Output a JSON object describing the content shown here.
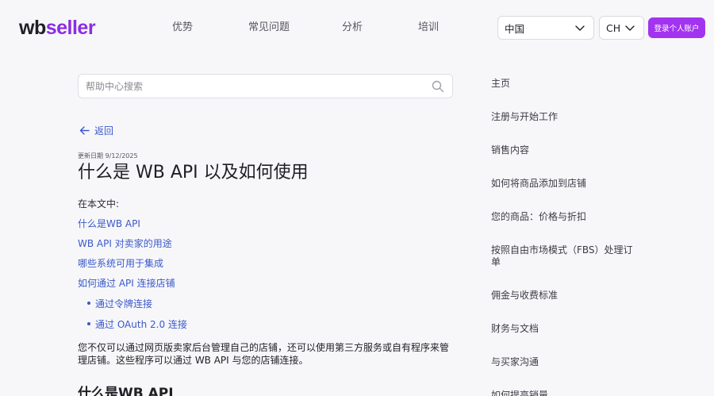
{
  "header": {
    "logo_wb": "wb",
    "logo_seller": "seller",
    "nav": [
      "优势",
      "常见问题",
      "分析",
      "培训"
    ],
    "country": "中国",
    "language": "CH",
    "login_label": "登录个人账户"
  },
  "search": {
    "placeholder": "帮助中心搜索"
  },
  "article": {
    "back_label": "返回",
    "updated": "更新日期 9/12/2025",
    "title": "什么是 WB API 以及如何使用",
    "toc_label": "在本文中:",
    "toc": [
      "什么是WB API",
      "WB API 对卖家的用途",
      "哪些系统可用于集成",
      "如何通过 API 连接店铺"
    ],
    "toc_sub": [
      "通过令牌连接",
      "通过 OAuth 2.0 连接"
    ],
    "intro": "您不仅可以通过网页版卖家后台管理自己的店铺，还可以使用第三方服务或自有程序来管理店铺。这些程序可以通过 WB API 与您的店铺连接。",
    "section_title": "什么是WB API"
  },
  "sidebar": {
    "items": [
      "主页",
      "注册与开始工作",
      "销售内容",
      "如何将商品添加到店铺",
      "您的商品：价格与折扣",
      "按照自由市场模式（FBS）处理订单",
      "佣金与收费标准",
      "财务与文档",
      "与买家沟通",
      "如何提高销量"
    ]
  },
  "colors": {
    "accent": "#a234f0",
    "link": "#3a59c9",
    "background": "#f7f7fa"
  },
  "icons": {
    "search": "search-icon",
    "back": "arrow-left-icon",
    "dropdown": "chevron-down-icon"
  }
}
